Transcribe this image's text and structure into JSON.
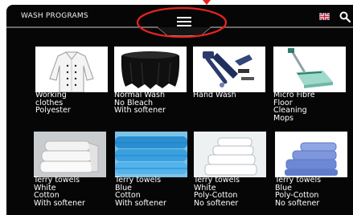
{
  "header": {
    "title": "WASH PROGRAMS",
    "menu_icon": "hamburger-menu-icon",
    "language_icon": "uk-flag-icon",
    "search_icon": "search-icon",
    "annotation_color": "#e8231f"
  },
  "programs": [
    {
      "lines": [
        "Working",
        "clothes",
        "Polyester"
      ],
      "image": "chef-jacket"
    },
    {
      "lines": [
        "Normal Wash",
        "No Bleach",
        "With softener"
      ],
      "image": "black-tablecloth"
    },
    {
      "lines": [
        "Hand Wash"
      ],
      "image": "clothing-items"
    },
    {
      "lines": [
        "Micro Fibre",
        "Floor",
        "Cleaning",
        "Mops"
      ],
      "image": "floor-mop"
    },
    {
      "lines": [
        "Terry towels",
        "White",
        "Cotton",
        "With softener"
      ],
      "image": "white-towels"
    },
    {
      "lines": [
        "Terry towels",
        "Blue",
        "Cotton",
        "With softener"
      ],
      "image": "blue-towels"
    },
    {
      "lines": [
        "Terry towels",
        "White",
        "Poly-Cotton",
        "No softener"
      ],
      "image": "white-towel-stack"
    },
    {
      "lines": [
        "Terry towels",
        "Blue",
        "Poly-Cotton",
        "No softener"
      ],
      "image": "blue-towel-stack"
    }
  ]
}
